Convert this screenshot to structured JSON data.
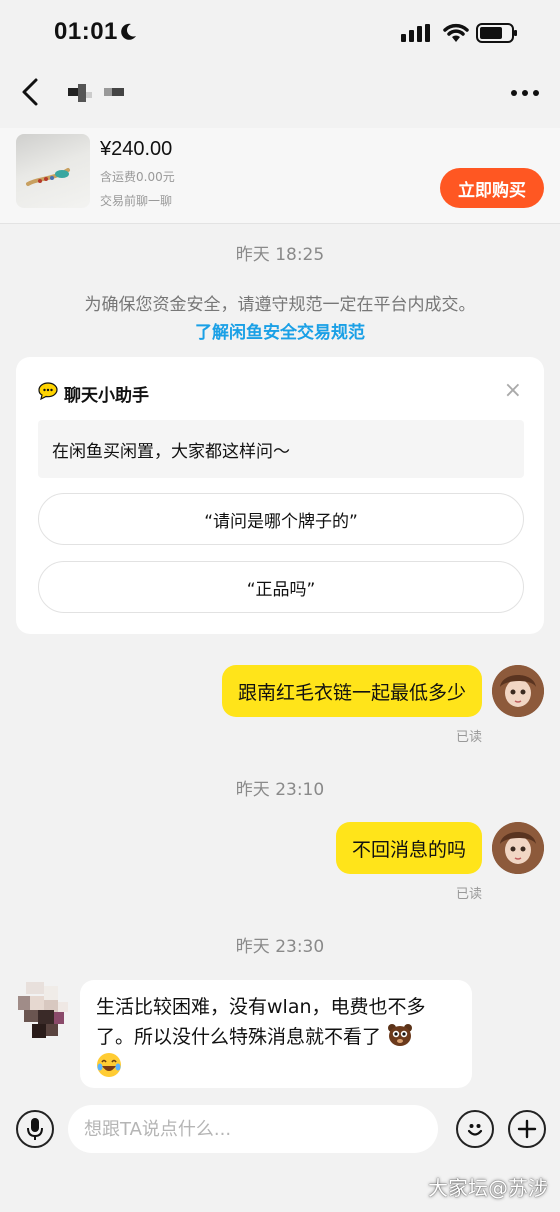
{
  "status_bar": {
    "time": "01:01"
  },
  "header": {
    "more_icon": "more-dots-icon"
  },
  "product": {
    "price": "¥240.00",
    "shipping": "含运费0.00元",
    "chat_first": "交易前聊一聊",
    "buy_label": "立即购买"
  },
  "messages": {
    "time_1": "昨天 18:25",
    "notice": "为确保您资金安全，请遵守规范一定在平台内成交。",
    "notice_link": "了解闲鱼安全交易规范",
    "assistant": {
      "title": "聊天小助手",
      "prompt": "在闲鱼买闲置，大家都这样问～",
      "suggestions": [
        "“请问是哪个牌子的”",
        "“正品吗”"
      ]
    },
    "me_1": "跟南红毛衣链一起最低多少",
    "read_1": "已读",
    "time_2": "昨天 23:10",
    "me_2": "不回消息的吗",
    "read_2": "已读",
    "time_3": "昨天 23:30",
    "other_1_line1": "生活比较困难，没有wlan，电费也不多",
    "other_1_line2": "了。所以没什么特殊消息就不看了"
  },
  "input": {
    "placeholder": "想跟TA说点什么..."
  },
  "watermark": "大家坛@苏涉",
  "colors": {
    "accent_buy": "#ff5722",
    "bubble_me": "#ffe41a",
    "link": "#1aa0e6",
    "background": "#f2f2f2"
  }
}
